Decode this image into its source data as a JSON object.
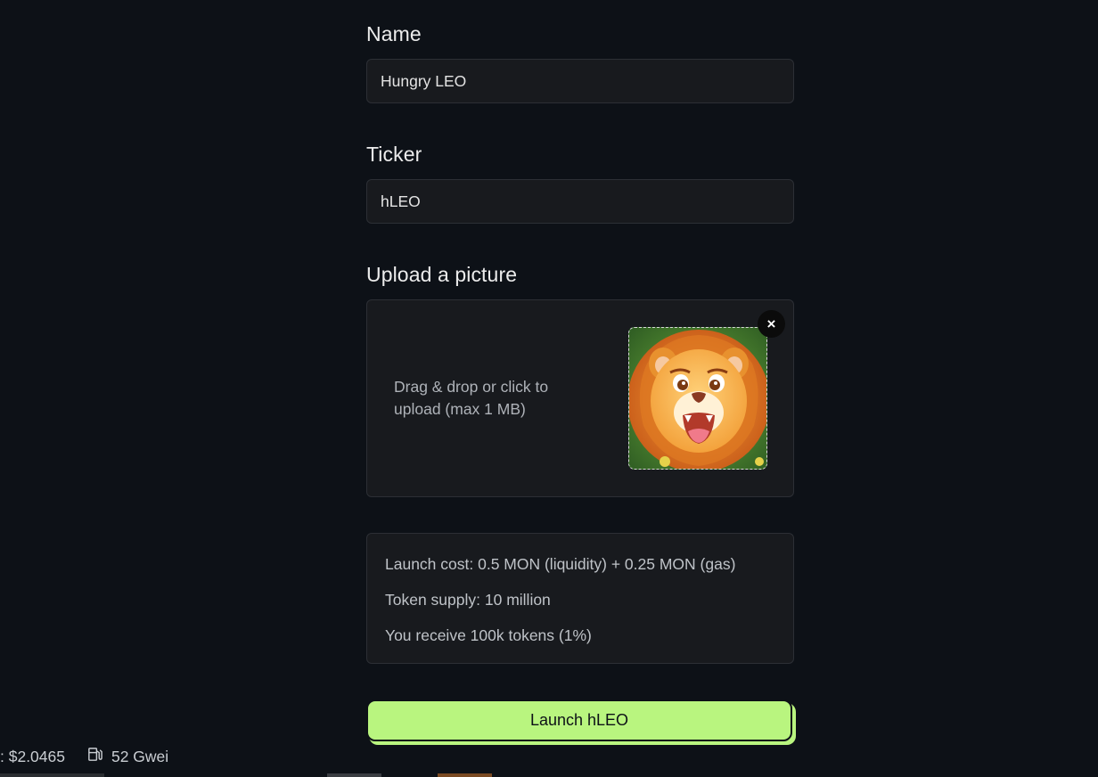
{
  "form": {
    "name": {
      "label": "Name",
      "value": "Hungry LEO"
    },
    "ticker": {
      "label": "Ticker",
      "value": "hLEO"
    },
    "upload": {
      "label": "Upload a picture",
      "hint": "Drag & drop or click to upload (max 1 MB)",
      "remove_glyph": "×",
      "preview_icon": "lion-avatar-image"
    },
    "info": {
      "lines": [
        "Launch cost: 0.5 MON (liquidity) + 0.25 MON (gas)",
        "Token supply: 10 million",
        "You receive 100k tokens (1%)"
      ]
    },
    "launch_button": "Launch hLEO"
  },
  "status_bar": {
    "price": ": $2.0465",
    "gas_icon": "gas-pump-icon",
    "gas": "52 Gwei"
  },
  "colors": {
    "background": "#0d1117",
    "field_bg": "#181a1e",
    "accent": "#b9f57f"
  }
}
